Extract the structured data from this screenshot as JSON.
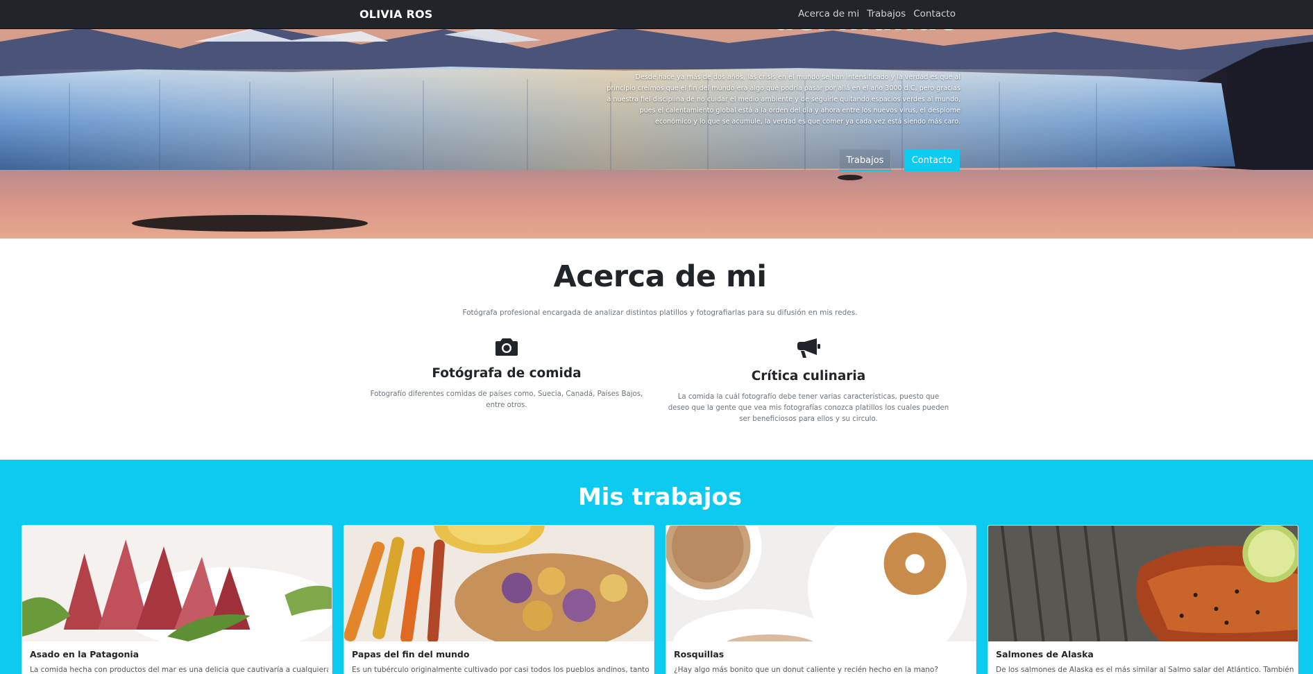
{
  "nav": {
    "brand": "OLIVIA ROS",
    "links": [
      "Acerca de mi",
      "Trabajos",
      "Contacto"
    ]
  },
  "hero": {
    "title": "del mundo",
    "text": "Desde hace ya más de dos años, las crisis en el mundo se han intensificado y la verdad es que al principio creímos que el fin del mundo era algo que podría pasar por allá en el año 3000 d.C, pero gracias a nuestra fiel disciplina de no cuidar el medio ambiente y de seguirle quitando espacios verdes al mundo, pues el calentamiento global está a la orden del día y ahora entre los nuevos virus, el desplome económico y lo que se acumule, la verdad es que comer ya cada vez está siendo más caro.",
    "btn_works": "Trabajos",
    "btn_contact": "Contacto"
  },
  "about": {
    "title": "Acerca de mi",
    "subtitle": "Fotógrafa profesional encargada de analizar distintos platillos y fotografiarlas para su difusión en mis redes.",
    "features": [
      {
        "icon": "camera-icon",
        "title": "Fotógrafa de comida",
        "text": "Fotografío diferentes comidas de países como, Suecia, Canadá, Países Bajos, entre otros."
      },
      {
        "icon": "megaphone-icon",
        "title": "Crítica culinaria",
        "text": "La comida la cuál fotografío debe tener varias características, puesto que deseo que la gente que vea mis fotografías conozca platillos los cuales pueden ser beneficiosos para ellos y su circulo."
      }
    ]
  },
  "works": {
    "title": "Mis trabajos",
    "cards": [
      {
        "title": "Asado en la Patagonia",
        "text": "La comida hecha con productos del mar es una delicia que cautivaría a cualquiera"
      },
      {
        "title": "Papas del fin del mundo",
        "text": "Es un tubérculo originalmente cultivado por casi todos los pueblos andinos, tanto en"
      },
      {
        "title": "Rosquillas",
        "text": "¿Hay algo más bonito que un donut caliente y recién hecho en la mano?"
      },
      {
        "title": "Salmones de Alaska",
        "text": "De los salmones de Alaska es el más similar al Salmo salar del Atlántico. También"
      }
    ]
  },
  "colors": {
    "navbar": "#212529",
    "accent": "#0dcaf0",
    "text_dark": "#212529",
    "text_muted": "#6c757d"
  }
}
